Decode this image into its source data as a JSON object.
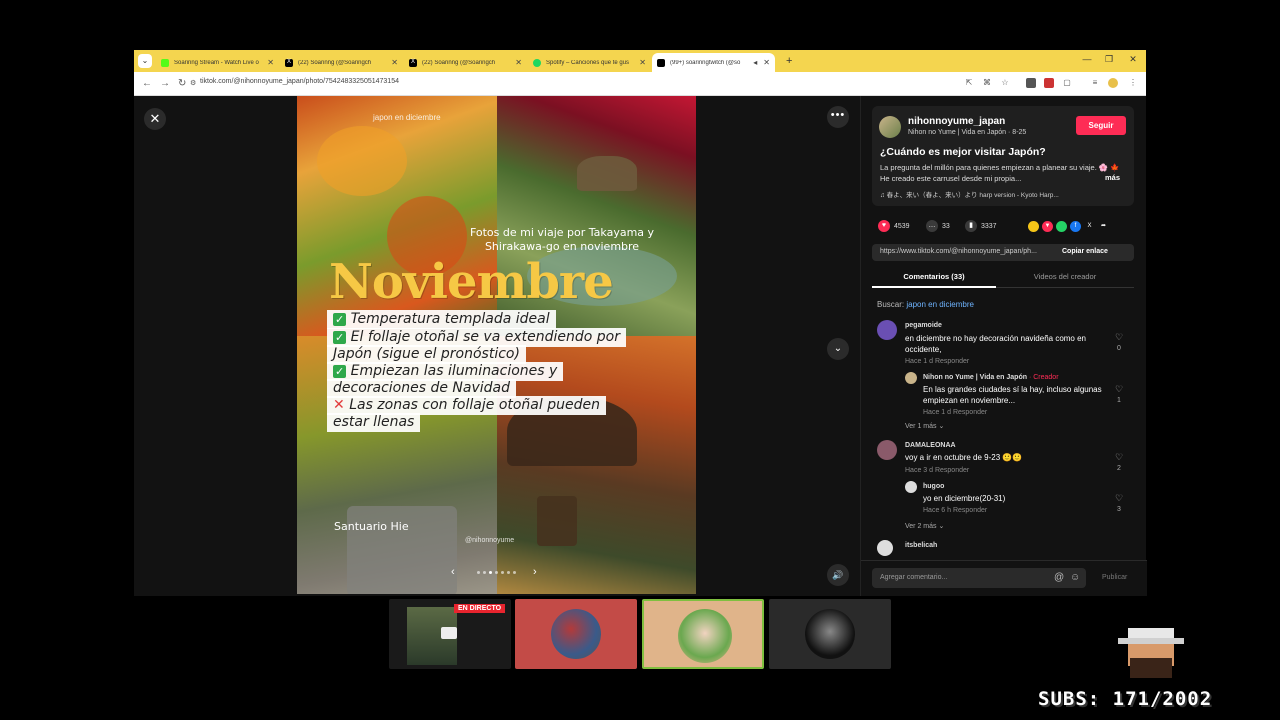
{
  "browser": {
    "tabs": [
      {
        "label": "Soarinng Stream - Watch Live o",
        "color": "#53fc18"
      },
      {
        "label": "(22) Soarinng (@Soaringch",
        "color": "#000000"
      },
      {
        "label": "(22) Soarinng (@Soaringch",
        "color": "#000000"
      },
      {
        "label": "Spotify – Canciones que te gus",
        "color": "#1ed760"
      },
      {
        "label": "(99+) soarinngtwitch (@so",
        "color": "#000000"
      }
    ],
    "new_tab": "+",
    "url": "tiktok.com/@nihonnoyume_japan/photo/7542483325051473154"
  },
  "photo": {
    "tag": "japon en diciembre",
    "caption": "Fotos de mi viaje por Takayama y Shirakawa-go en noviembre",
    "month": "Noviembre",
    "checklist": [
      {
        "mark": "✓",
        "text": "Temperatura templada ideal"
      },
      {
        "mark": "✓",
        "text": "El follaje otoñal se va extendiendo por"
      },
      {
        "mark": "",
        "text": "Japón (sigue el pronóstico)"
      },
      {
        "mark": "✓",
        "text": "Empiezan las iluminaciones y"
      },
      {
        "mark": "",
        "text": "decoraciones de Navidad"
      },
      {
        "mark": "✕",
        "text": "Las zonas con follaje otoñal pueden"
      },
      {
        "mark": "",
        "text": "estar llenas"
      }
    ],
    "shrine": "Santuario Hie",
    "handle": "@nihonnoyume"
  },
  "post": {
    "author": "nihonnoyume_japan",
    "author_sub": "Nihon no Yume | Vida en Japón · 8-25",
    "follow": "Seguir",
    "title": "¿Cuándo es mejor visitar Japón?",
    "desc": "La pregunta del millón para quienes empiezan a planear su viaje. 🌸 🍁 He creado este carrusel desde mi propia...",
    "more": "más",
    "music": "♫ 春よ、来い（春よ、来い）より harp version - Kyoto Harp...",
    "likes": "4539",
    "comments_count": "33",
    "saves": "3337",
    "link": "https://www.tiktok.com/@nihonnoyume_japan/ph...",
    "copy_link": "Copiar enlace"
  },
  "tabs": {
    "comments": "Comentarios (33)",
    "creator": "Videos del creador"
  },
  "search": {
    "prefix": "Buscar:",
    "query": "japon en diciembre"
  },
  "comments": [
    {
      "user": "pegamoide",
      "text": "en diciembre no hay decoración navideña como en occidente,",
      "meta": "Hace 1 d    Responder",
      "likes": "0"
    },
    {
      "user": "Nihon no Yume | Vida en Japón",
      "creator": "· Creador",
      "text": "En las grandes ciudades sí la hay, incluso algunas empiezan en noviembre...",
      "meta": "Hace 1 d    Responder",
      "likes": "1"
    },
    {
      "more": "Ver 1 más ⌄"
    },
    {
      "user": "DAMALEONAA",
      "text": "voy a ir en octubre de 9-23 🙂🙂",
      "meta": "Hace 3 d    Responder",
      "likes": "2"
    },
    {
      "user": "hugoo",
      "text": "yo en diciembre(20-31)",
      "meta": "Hace 6 h    Responder",
      "likes": "3"
    },
    {
      "more": "Ver 2 más ⌄"
    },
    {
      "user": "itsbelicah"
    }
  ],
  "comment_bar": {
    "placeholder": "Agregar comentario...",
    "publish": "Publicar"
  },
  "stream": {
    "live": "EN DIRECTO",
    "subs": "SUBS: 171/2002"
  },
  "colors": {
    "accent": "#fe2c55",
    "tabbar": "#f4d54f",
    "month": "#f6c845"
  }
}
